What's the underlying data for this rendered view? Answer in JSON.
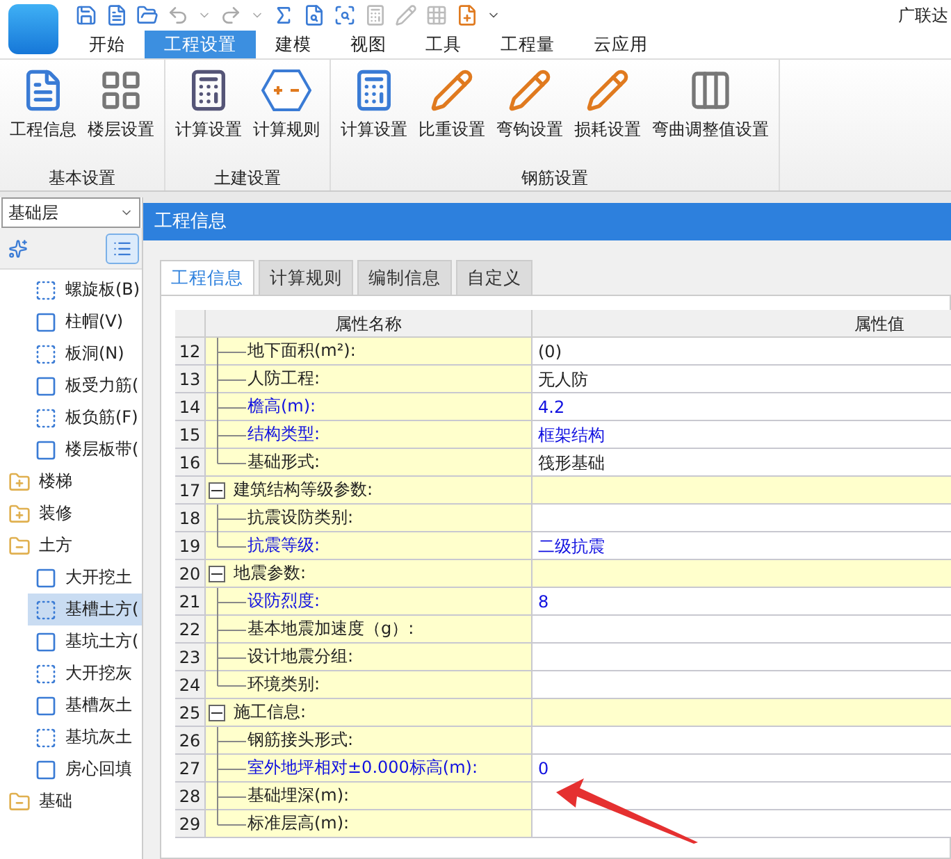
{
  "app": {
    "title": "广联达"
  },
  "menu_tabs": [
    {
      "label": "开始",
      "selected": false
    },
    {
      "label": "工程设置",
      "selected": true
    },
    {
      "label": "建模",
      "selected": false
    },
    {
      "label": "视图",
      "selected": false
    },
    {
      "label": "工具",
      "selected": false
    },
    {
      "label": "工程量",
      "selected": false
    },
    {
      "label": "云应用",
      "selected": false
    }
  ],
  "ribbon_groups": [
    {
      "label": "基本设置",
      "buttons": [
        {
          "label": "工程信息"
        },
        {
          "label": "楼层设置"
        }
      ]
    },
    {
      "label": "土建设置",
      "buttons": [
        {
          "label": "计算设置"
        },
        {
          "label": "计算规则"
        }
      ]
    },
    {
      "label": "钢筋设置",
      "buttons": [
        {
          "label": "计算设置"
        },
        {
          "label": "比重设置"
        },
        {
          "label": "弯钩设置"
        },
        {
          "label": "损耗设置"
        },
        {
          "label": "弯曲调整值设置"
        }
      ]
    }
  ],
  "floor_select": {
    "value": "基础层"
  },
  "tree": {
    "continued_items": [
      {
        "label": "螺旋板(B)",
        "selected": false
      },
      {
        "label": "柱帽(V)",
        "selected": false
      },
      {
        "label": "板洞(N)",
        "selected": false
      },
      {
        "label": "板受力筋(",
        "selected": false
      },
      {
        "label": "板负筋(F)",
        "selected": false
      },
      {
        "label": "楼层板带(",
        "selected": false
      }
    ],
    "folders": [
      {
        "label": "楼梯",
        "expanded": false
      },
      {
        "label": "装修",
        "expanded": false
      },
      {
        "label": "土方",
        "expanded": true,
        "children": [
          {
            "label": "大开挖土",
            "selected": false
          },
          {
            "label": "基槽土方(",
            "selected": true
          },
          {
            "label": "基坑土方(",
            "selected": false
          },
          {
            "label": "大开挖灰",
            "selected": false
          },
          {
            "label": "基槽灰土",
            "selected": false
          },
          {
            "label": "基坑灰土",
            "selected": false
          },
          {
            "label": "房心回填",
            "selected": false
          }
        ]
      },
      {
        "label": "基础",
        "expanded": true
      }
    ]
  },
  "dialog": {
    "title": "工程信息",
    "tabs": [
      {
        "label": "工程信息",
        "selected": true
      },
      {
        "label": "计算规则",
        "selected": false
      },
      {
        "label": "编制信息",
        "selected": false
      },
      {
        "label": "自定义",
        "selected": false
      }
    ],
    "columns": [
      "属性名称",
      "属性值"
    ],
    "rows": [
      {
        "kind": "field",
        "number": "12",
        "name": "地下面积(m²):",
        "value": "(0)",
        "emphasized": false
      },
      {
        "kind": "field",
        "number": "13",
        "name": "人防工程:",
        "value": "无人防",
        "emphasized": false
      },
      {
        "kind": "field",
        "number": "14",
        "name": "檐高(m):",
        "value": "4.2",
        "emphasized": true
      },
      {
        "kind": "field",
        "number": "15",
        "name": "结构类型:",
        "value": "框架结构",
        "emphasized": true
      },
      {
        "kind": "field",
        "number": "16",
        "name": "基础形式:",
        "value": "筏形基础",
        "emphasized": false
      },
      {
        "kind": "group",
        "number": "17",
        "name": "建筑结构等级参数:",
        "expanded": true,
        "children": [
          {
            "kind": "field",
            "number": "18",
            "name": "抗震设防类别:",
            "emphasized": false
          },
          {
            "kind": "field",
            "number": "19",
            "name": "抗震等级:",
            "value": "二级抗震",
            "emphasized": true
          }
        ]
      },
      {
        "kind": "group",
        "number": "20",
        "name": "地震参数:",
        "expanded": true,
        "children": [
          {
            "kind": "field",
            "number": "21",
            "name": "设防烈度:",
            "value": "8",
            "emphasized": true
          },
          {
            "kind": "field",
            "number": "22",
            "name": "基本地震加速度（g）:",
            "emphasized": false
          },
          {
            "kind": "field",
            "number": "23",
            "name": "设计地震分组:",
            "emphasized": false
          },
          {
            "kind": "field",
            "number": "24",
            "name": "环境类别:",
            "emphasized": false
          }
        ]
      },
      {
        "kind": "group",
        "number": "25",
        "name": "施工信息:",
        "expanded": true,
        "children": [
          {
            "kind": "field",
            "number": "26",
            "name": "钢筋接头形式:",
            "emphasized": false
          },
          {
            "kind": "field",
            "number": "27",
            "name": "室外地坪相对±0.000标高(m):",
            "value": "0",
            "emphasized": true
          },
          {
            "kind": "field",
            "number": "28",
            "name": "基础埋深(m):",
            "emphasized": false
          },
          {
            "kind": "field",
            "number": "29",
            "name": "标准层高(m):",
            "emphasized": false
          }
        ]
      }
    ]
  }
}
